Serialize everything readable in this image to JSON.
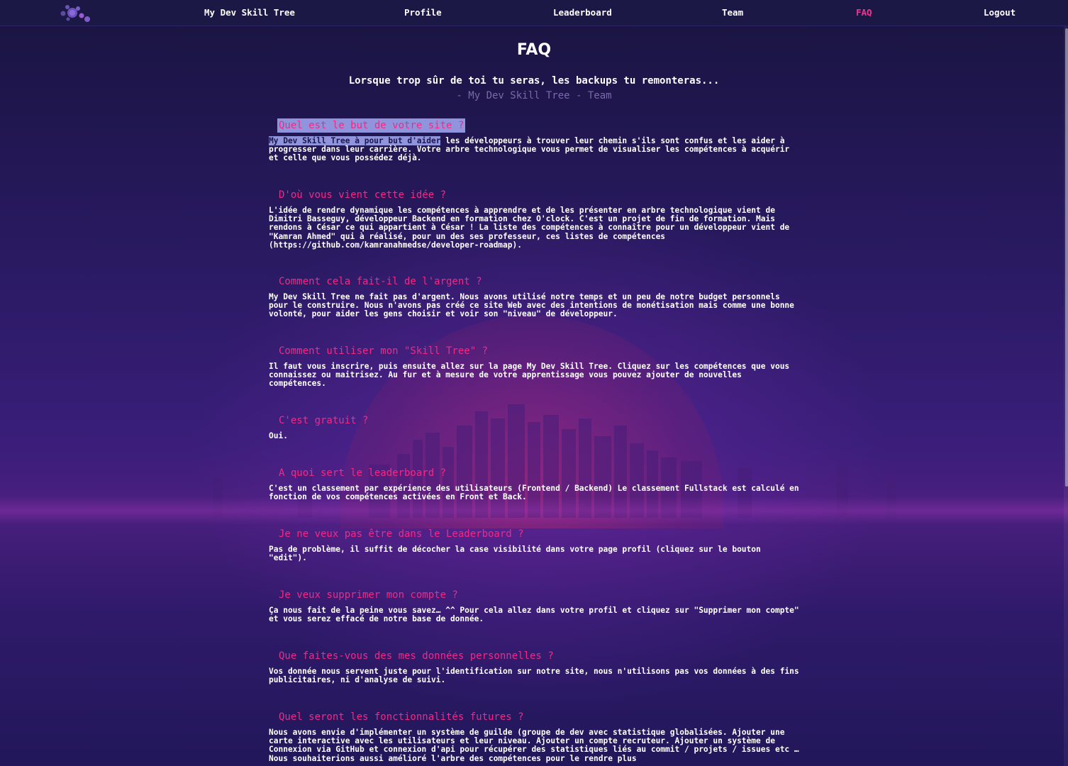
{
  "nav": {
    "logo_icon": "molecule-logo-icon",
    "links": [
      {
        "label": "My Dev Skill Tree",
        "active": false
      },
      {
        "label": "Profile",
        "active": false
      },
      {
        "label": "Leaderboard",
        "active": false
      },
      {
        "label": "Team",
        "active": false
      },
      {
        "label": "FAQ",
        "active": true
      },
      {
        "label": "Logout",
        "active": false
      }
    ]
  },
  "page": {
    "title": "FAQ",
    "quote": "Lorsque trop sûr de toi tu seras, les backups tu remonteras...",
    "quote_author": "- My Dev Skill Tree - Team"
  },
  "colors": {
    "accent": "#f12a86",
    "active_nav": "#ff2d8f",
    "selection": "#8f94dc",
    "background": "#1c1547"
  },
  "faq": [
    {
      "question": "Quel est le but de votre site ?",
      "answer_selected": "My Dev Skill Tree à pour but d'aider",
      "answer": " les développeurs à trouver leur chemin s'ils sont confus et les aider à progresser dans leur carrière. Votre arbre technologique vous permet de visualiser les compétences à acquérir et celle que vous possédez déjà."
    },
    {
      "question": "D'où vous vient cette idée ?",
      "answer": "L'idée de rendre dynamique les compétences à apprendre et de les présenter en arbre technologique vient de Dimitri Basseguy, développeur Backend en formation chez O'clock. C'est un projet de fin de formation. Mais rendons à César ce qui appartient à César ! La liste des compétences à connaître pour un développeur vient de \"Kamran Ahmed\" qui à réalisé, pour un des ses professeur, ces listes de compétences (https://github.com/kamranahmedse/developer-roadmap)."
    },
    {
      "question": "Comment cela fait-il de l'argent ?",
      "answer": "My Dev Skill Tree ne fait pas d'argent. Nous avons utilisé notre temps et un peu de notre budget personnels pour le construire. Nous n'avons pas créé ce site Web avec des intentions de monétisation mais comme une bonne volonté, pour aider les gens choisir et voir son \"niveau\" de développeur."
    },
    {
      "question": "Comment utiliser mon \"Skill Tree\" ?",
      "answer": "Il faut vous inscrire, puis ensuite allez sur la page My Dev Skill Tree. Cliquez sur les compétences que vous connaissez ou maitrisez. Au fur et à mesure de votre apprentissage vous pouvez ajouter de nouvelles compétences."
    },
    {
      "question": "C'est gratuit ?",
      "answer": "Oui."
    },
    {
      "question": "A quoi sert le leaderboard ?",
      "answer": "C'est un classement par expérience des utilisateurs (Frontend / Backend) Le classement Fullstack est calculé en fonction de vos compétences activées en Front et Back."
    },
    {
      "question": "Je ne veux pas être dans le Leaderboard ?",
      "answer": "Pas de problème, il suffit de décocher la case visibilité dans votre page profil (cliquez sur le bouton \"edit\")."
    },
    {
      "question": "Je veux supprimer mon compte ?",
      "answer": "Ça nous fait de la peine vous savez… ^^ Pour cela allez dans votre profil et cliquez sur \"Supprimer mon compte\" et vous serez effacé de notre base de donnée."
    },
    {
      "question": "Que faites-vous des mes données personnelles ?",
      "answer": "Vos donnée nous servent juste pour l'identification sur notre site, nous n'utilisons pas vos données à des fins publicitaires, ni d'analyse de suivi."
    },
    {
      "question": "Quel seront les fonctionnalités futures ?",
      "answer": "Nous avons envie d'implémenter un système de guilde (groupe de dev avec statistique globalisées. Ajouter une carte interactive avec les utilisateurs et leur niveau. Ajouter un compte recruteur. Ajouter un système de Connexion via GitHub et connexion d'api pour récupérer des statistiques liés au commit / projets / issues etc … Nous souhaiterions aussi amélioré l'arbre des compétences pour le rendre plus"
    }
  ]
}
